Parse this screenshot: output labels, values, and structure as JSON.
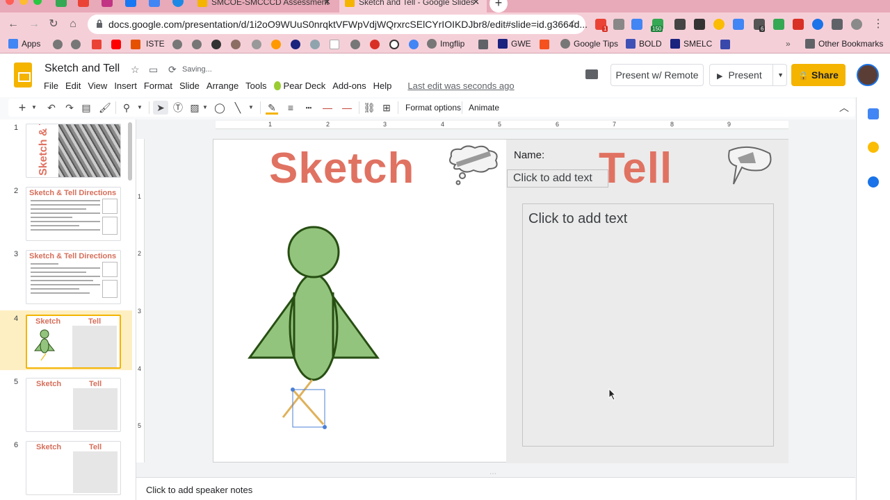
{
  "browser": {
    "tabs": [
      {
        "title": "SMCOE-SMCCCD Assessment"
      },
      {
        "title": "Sketch and Tell - Google Slides"
      }
    ],
    "url": "docs.google.com/presentation/d/1i2oO9WUuS0nrqktVFWpVdjWQrxrcSElCYrIOIKDJbr8/edit#slide=id.g3664d...",
    "extension_badges": [
      "1",
      "150",
      "6",
      "6"
    ],
    "bookmarks": [
      "Apps",
      "ISTE",
      "Imgflip",
      "GWE",
      "Google Tips",
      "BOLD",
      "SMELC"
    ],
    "other_bookmarks": "Other Bookmarks"
  },
  "app": {
    "doc_title": "Sketch and Tell",
    "saving_status": "Saving...",
    "menu": [
      "File",
      "Edit",
      "View",
      "Insert",
      "Format",
      "Slide",
      "Arrange",
      "Tools",
      "Pear Deck",
      "Add-ons",
      "Help"
    ],
    "last_edit": "Last edit was seconds ago",
    "present_remote": "Present w/ Remote",
    "present": "Present",
    "share": "Share"
  },
  "toolbar": {
    "format_options": "Format options",
    "animate": "Animate"
  },
  "filmstrip": {
    "slides": [
      {
        "num": "1",
        "title": "Sketch & Tell"
      },
      {
        "num": "2",
        "title": "Sketch & Tell Directions"
      },
      {
        "num": "3",
        "title": "Sketch & Tell Directions"
      },
      {
        "num": "4",
        "title_left": "Sketch",
        "title_right": "Tell"
      },
      {
        "num": "5",
        "title_left": "Sketch",
        "title_right": "Tell"
      },
      {
        "num": "6",
        "title_left": "Sketch",
        "title_right": "Tell"
      }
    ]
  },
  "ruler": {
    "h": [
      "1",
      "2",
      "3",
      "4",
      "5",
      "6",
      "7",
      "8",
      "9"
    ],
    "v": [
      "1",
      "2",
      "3",
      "4",
      "5"
    ]
  },
  "slide": {
    "sketch_word": "Sketch",
    "tell_word": "Tell",
    "name_label": "Name:",
    "name_placeholder": "Click to add text",
    "tell_placeholder": "Click to add text"
  },
  "notes": {
    "placeholder": "Click to add speaker notes"
  },
  "colors": {
    "accent": "#f4b400",
    "title_red": "#e07262",
    "figure_green": "#93c47d"
  }
}
